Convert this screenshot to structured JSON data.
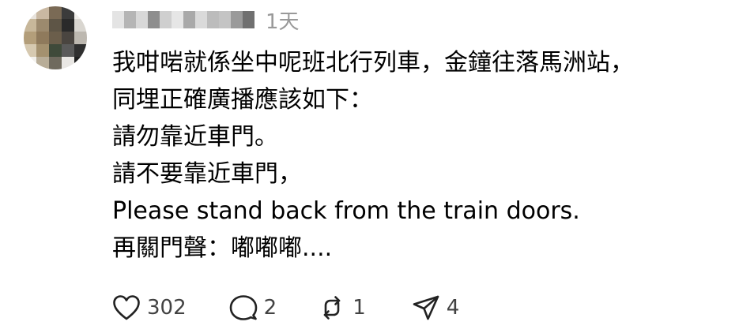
{
  "post": {
    "time": "1天",
    "lines": [
      "我咁啱就係坐中呢班北行列車，金鐘往落馬洲站，",
      "同埋正確廣播應該如下：",
      "請勿靠近車門。",
      "請不要靠近車門，",
      "Please stand back from the train doors.",
      "再關門聲：嘟嘟嘟...."
    ]
  },
  "actions": {
    "like_count": "302",
    "reply_count": "2",
    "repost_count": "1",
    "share_count": "4"
  },
  "icons": {
    "like": "heart-icon",
    "reply": "speech-bubble-icon",
    "repost": "repost-arrows-icon",
    "share": "paper-plane-icon"
  }
}
